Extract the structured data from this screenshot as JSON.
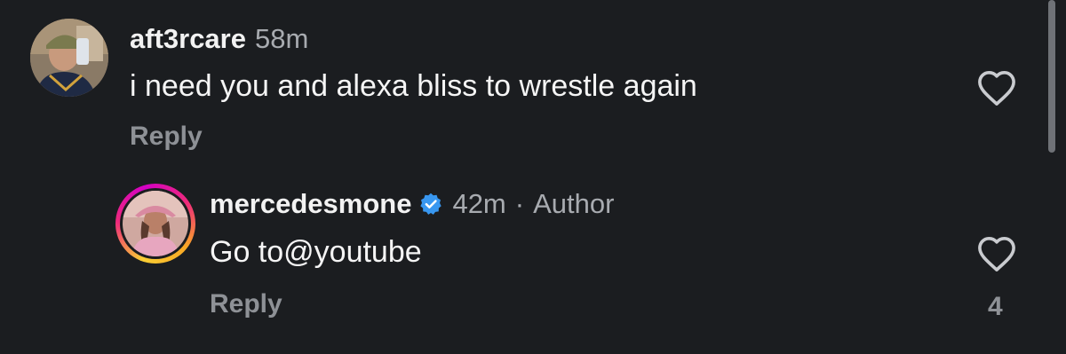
{
  "comments": [
    {
      "username": "aft3rcare",
      "time": "58m",
      "text": "i need you and alexa bliss to wrestle again",
      "reply_label": "Reply",
      "avatar_icon": "user-avatar"
    }
  ],
  "replies": [
    {
      "username": "mercedesmone",
      "verified": true,
      "time": "42m",
      "separator": "·",
      "badge": "Author",
      "text": "Go to@youtube",
      "reply_label": "Reply",
      "like_count": "4",
      "avatar_icon": "story-ring-avatar"
    }
  ],
  "colors": {
    "background": "#1b1d20",
    "muted_text": "#a8abb0",
    "verified_blue": "#3897f0"
  }
}
